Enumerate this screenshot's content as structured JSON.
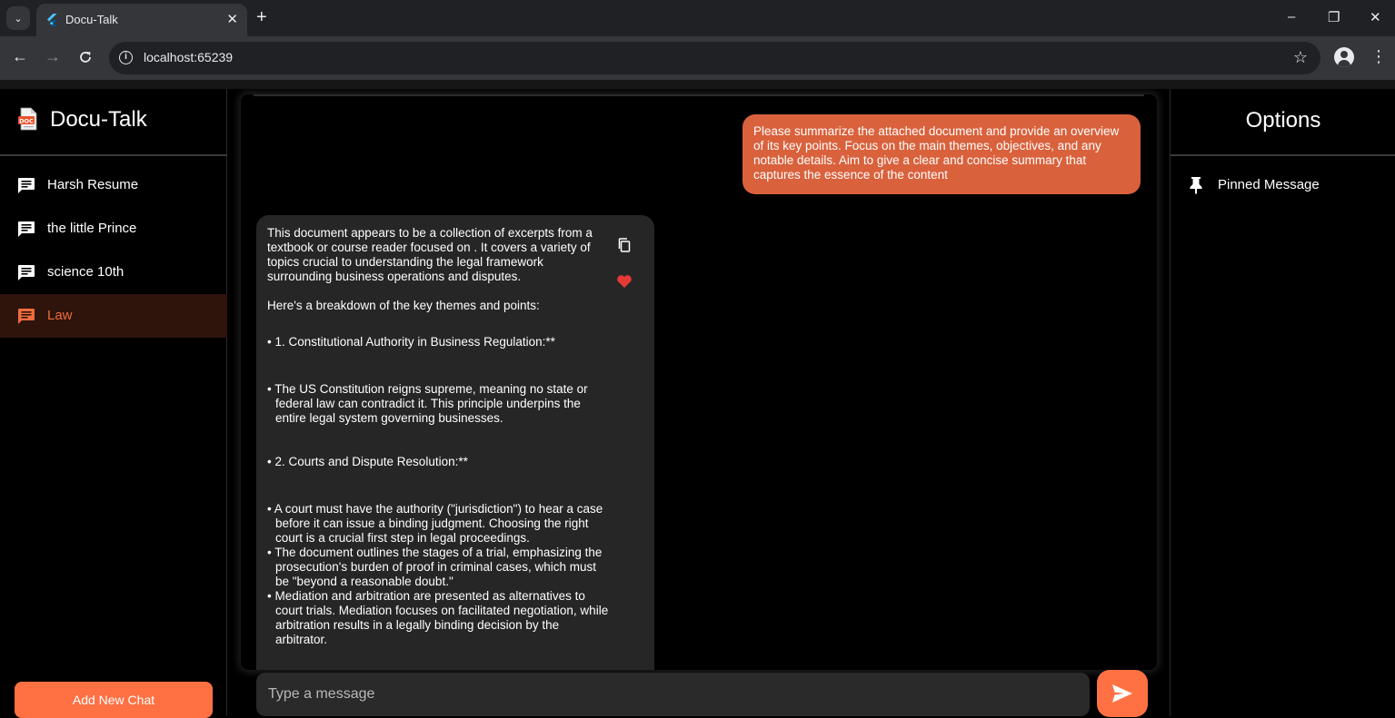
{
  "browser": {
    "tab_title": "Docu-Talk",
    "tab_close": "✕",
    "new_tab": "+",
    "url": "localhost:65239",
    "window_controls": {
      "minimize": "–",
      "restore": "❐",
      "close": "✕"
    },
    "icons": {
      "back": "arrow-left-icon",
      "forward": "arrow-right-icon",
      "reload": "reload-icon",
      "star": "star-icon",
      "profile": "profile-icon",
      "menu": "kebab-menu-icon"
    }
  },
  "sidebar": {
    "app_title": "Docu-Talk",
    "chats": [
      {
        "label": "Harsh Resume",
        "active": false
      },
      {
        "label": "the little Prince",
        "active": false
      },
      {
        "label": "science 10th",
        "active": false
      },
      {
        "label": "Law",
        "active": true
      }
    ],
    "add_button": "Add New Chat"
  },
  "chat": {
    "user_message": "Please summarize the attached document and provide an overview of its key points. Focus on the main themes, objectives, and any notable details. Aim to give a clear and concise summary that captures the essence of the content",
    "bot": {
      "intro": "This document appears to be a collection of excerpts from a textbook or course reader focused on . It covers a variety of topics crucial to understanding the legal framework surrounding business operations and disputes.",
      "breakdown": "Here's a breakdown of the key themes and points:",
      "h1": "• 1. Constitutional Authority in Business Regulation:**",
      "p1": "•  The US Constitution reigns supreme, meaning no state or federal law can contradict it. This principle underpins the entire legal system governing businesses.",
      "h2": "• 2. Courts and Dispute Resolution:**",
      "p2a": "•  A court must have the authority (\"jurisdiction\") to hear a case before it can issue a binding judgment. Choosing the right court is a crucial first step in legal proceedings.",
      "p2b": "• The document outlines the stages of a trial, emphasizing the prosecution's burden of proof in criminal cases, which must be \"beyond a reasonable doubt.\"",
      "p2c": "• Mediation and arbitration are presented as alternatives to court trials. Mediation focuses on facilitated negotiation, while arbitration results in a legally binding decision by the arbitrator."
    },
    "input_placeholder": "Type a message"
  },
  "options": {
    "title": "Options",
    "pinned": "Pinned Message"
  },
  "colors": {
    "accent": "#ff7043",
    "user_bubble": "#d9613c",
    "bot_bubble": "#262626",
    "active_bg": "#2e140b",
    "heart": "#e53935"
  }
}
